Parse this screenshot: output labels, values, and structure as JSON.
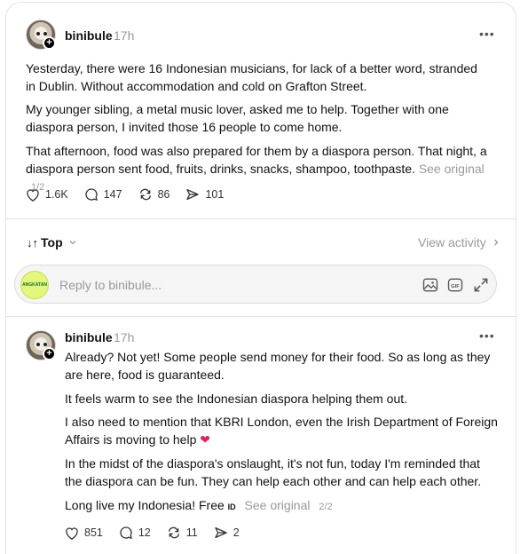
{
  "post": {
    "username": "binibule",
    "time": "17h",
    "paragraphs": [
      "Yesterday, there were 16 Indonesian musicians, for lack of a better word, stranded in Dublin. Without accommodation and cold on Grafton Street.",
      "My younger sibling, a metal music lover, asked me to help. Together with one diaspora person, I invited those 16 people to come home.",
      "That afternoon, food was also prepared for them by a diaspora person. That night, a diaspora person sent food, fruits, drinks, snacks, shampoo, toothpaste."
    ],
    "see_original": "See original",
    "pager": "1/2",
    "likes": "1.6K",
    "comments": "147",
    "reposts": "86",
    "shares": "101"
  },
  "replies_bar": {
    "sort_label": "Top",
    "view_activity": "View activity"
  },
  "reply_box": {
    "avatar_text": "ANGKATAN",
    "placeholder": "Reply to binibule..."
  },
  "reply": {
    "username": "binibule",
    "time": "17h",
    "paragraphs": [
      "Already? Not yet! Some people send money for their food. So as long as they are here, food is guaranteed.",
      "It feels warm to see the Indonesian diaspora helping them out.",
      "I also need to mention that KBRI London, even the Irish Department of Foreign Affairs is moving to help",
      "In the midst of the diaspora's onslaught, it's not fun, today I'm reminded that the diaspora can be fun. They can help each other and can help each other.",
      "Long live my Indonesia! Free"
    ],
    "flag_text": "ID",
    "see_original": "See original",
    "pager": "2/2",
    "likes": "851",
    "comments": "12",
    "reposts": "11",
    "shares": "2"
  },
  "colors": {
    "muted": "#999999",
    "heart": "#e0245e",
    "border": "#e2e2e2"
  }
}
